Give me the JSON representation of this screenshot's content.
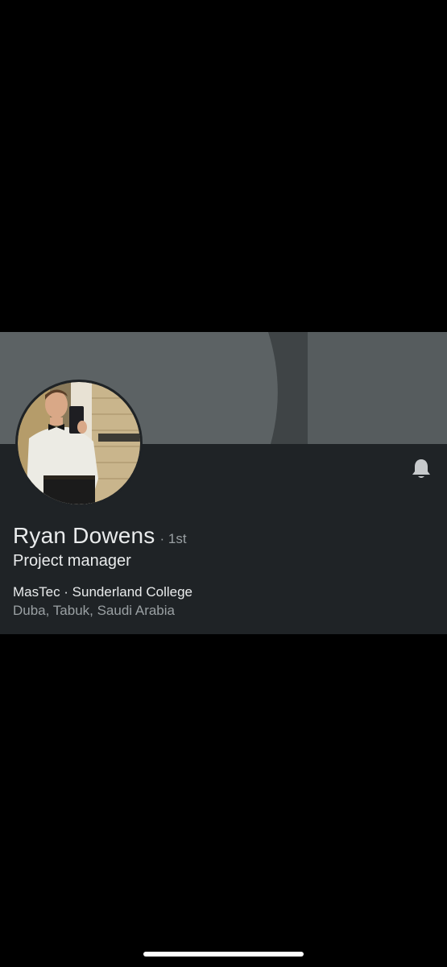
{
  "profile": {
    "name": "Ryan Dowens",
    "degree": "· 1st",
    "headline": "Project manager",
    "company_education": "MasTec · Sunderland College",
    "location": "Duba, Tabuk, Saudi Arabia"
  },
  "icons": {
    "notify": "bell-icon"
  },
  "colors": {
    "page_background": "#000000",
    "card_background": "#1f2326",
    "banner": "#5c6264",
    "primary_text": "#e9ebec",
    "secondary_text": "#9aa0a3"
  }
}
